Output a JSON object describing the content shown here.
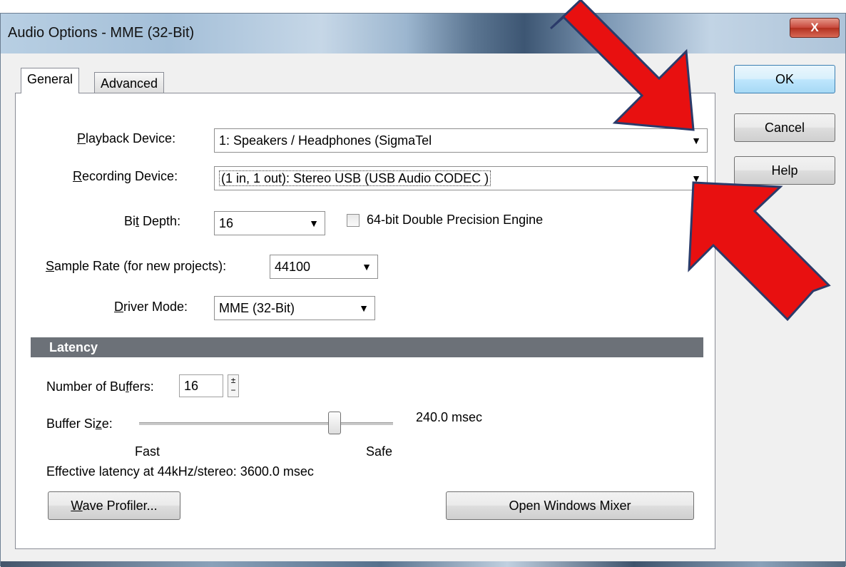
{
  "window": {
    "title": "Audio Options - MME (32-Bit)",
    "close_label": "X"
  },
  "tabs": [
    {
      "label": "General",
      "active": true
    },
    {
      "label": "Advanced",
      "active": false
    }
  ],
  "general": {
    "playback": {
      "label_underlined": "P",
      "label_rest": "layback Device:",
      "value": "1: Speakers / Headphones (SigmaTel"
    },
    "recording": {
      "label_underlined": "R",
      "label_rest": "ecording Device:",
      "value": "(1 in, 1 out): Stereo USB (USB Audio CODEC )"
    },
    "bit_depth": {
      "label_pre": "Bi",
      "label_underlined": "t",
      "label_post": " Depth:",
      "value": "16"
    },
    "double_precision": {
      "label": "64-bit Double Precision Engine",
      "checked": false
    },
    "sample_rate": {
      "label_underlined": "S",
      "label_rest": "ample Rate (for new projects):",
      "value": "44100"
    },
    "driver_mode": {
      "label_underlined": "D",
      "label_rest": "river Mode:",
      "value": "MME (32-Bit)"
    }
  },
  "latency": {
    "section_title": "Latency",
    "buffers": {
      "label_pre": "Number of Bu",
      "label_underlined": "f",
      "label_post": "fers:",
      "value": "16"
    },
    "buffer_size": {
      "label_pre": "Buffer Si",
      "label_underlined": "z",
      "label_post": "e:",
      "value_text": "240.0 msec",
      "slider_fraction": 0.77
    },
    "fast_label": "Fast",
    "safe_label": "Safe",
    "effective_latency": "Effective latency at 44kHz/stereo:  3600.0 msec"
  },
  "buttons": {
    "ok": "OK",
    "cancel": "Cancel",
    "help": "Help",
    "wave_profiler_underlined": "W",
    "wave_profiler_rest": "ave Profiler...",
    "open_mixer": "Open Windows Mixer"
  },
  "colors": {
    "annotation_arrow": "#e81010",
    "latency_header": "#6c7178"
  }
}
